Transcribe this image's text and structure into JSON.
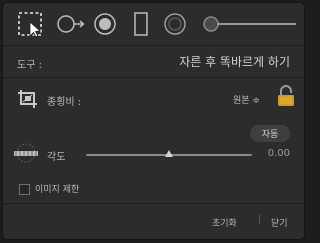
{
  "toolbar": {
    "tools": [
      {
        "icon": "crop-overlay-icon",
        "selected": true
      },
      {
        "icon": "spot-removal-icon",
        "selected": false
      },
      {
        "icon": "red-eye-icon",
        "selected": false
      },
      {
        "icon": "graduated-filter-icon",
        "selected": false
      },
      {
        "icon": "radial-filter-icon",
        "selected": false
      },
      {
        "icon": "adjustment-brush-icon",
        "selected": false
      }
    ]
  },
  "tool_row": {
    "label": "도구 :",
    "value": "자른 후 똑바르게 하기"
  },
  "aspect": {
    "label": "종횡비 :",
    "value": "원본 ≑",
    "locked": true
  },
  "angle": {
    "auto_label": "자동",
    "label": "각도",
    "value": "0.00",
    "slider_fraction": 0.5
  },
  "constrain": {
    "label": "이미지 제한",
    "checked": false
  },
  "footer": {
    "reset_label": "초기화",
    "separator": "|",
    "close_label": "닫기"
  },
  "colors": {
    "panel_bg": "#2c2c2c",
    "text": "#b8b8b8",
    "lock": "#c99a1c"
  }
}
